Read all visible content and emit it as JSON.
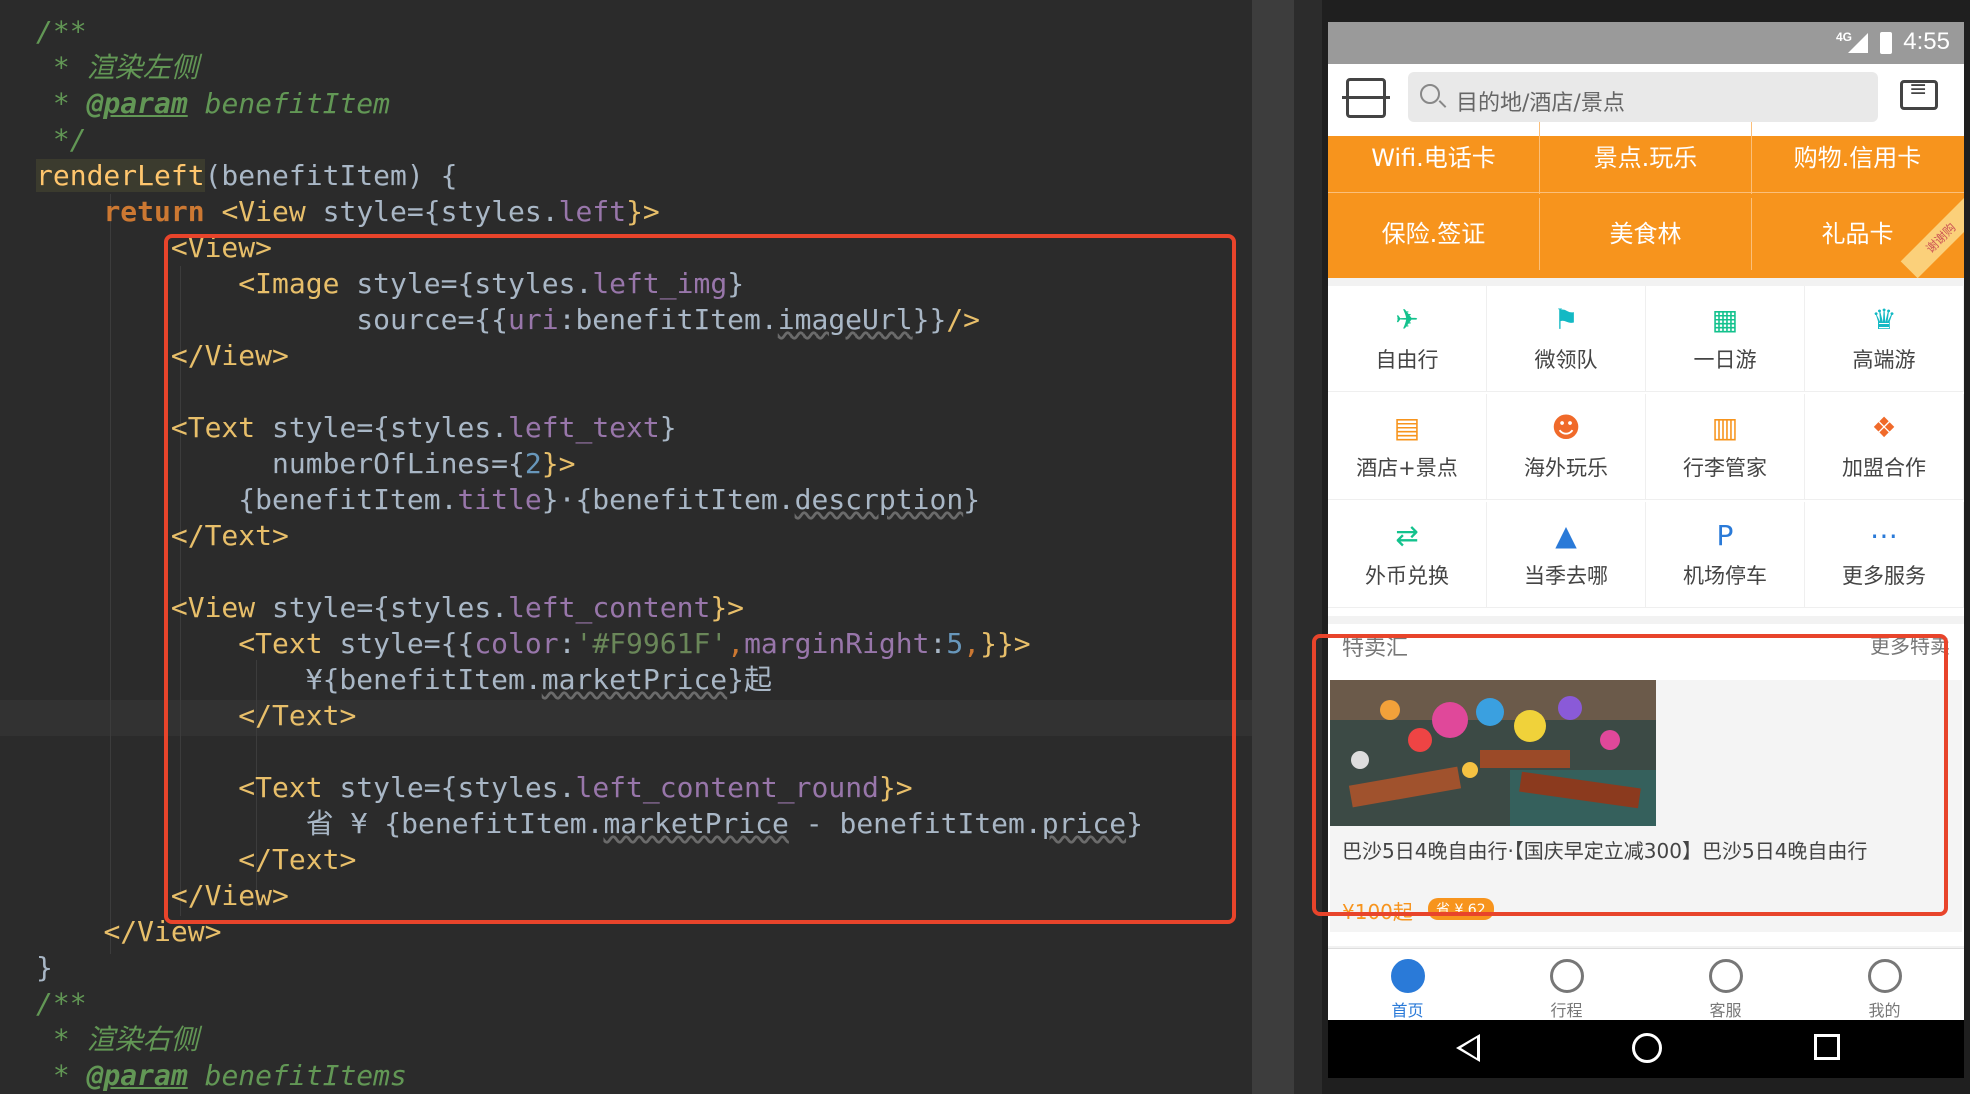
{
  "code": {
    "lines": [
      [
        {
          "t": "/**",
          "c": "c-comment"
        }
      ],
      [
        {
          "t": " * 渲染左侧",
          "c": "c-comment"
        }
      ],
      [
        {
          "t": " * ",
          "c": "c-comment"
        },
        {
          "t": "@param",
          "c": "c-tag-d"
        },
        {
          "t": " benefitItem",
          "c": "c-comment"
        }
      ],
      [
        {
          "t": " */",
          "c": "c-comment"
        }
      ],
      [
        {
          "t": "renderLeft",
          "c": "c-method"
        },
        {
          "t": "(benefitItem) {",
          "c": "c-plain"
        }
      ],
      [
        {
          "t": "    ",
          "c": "c-plain"
        },
        {
          "t": "return",
          "c": "c-kw"
        },
        {
          "t": " ",
          "c": "c-plain"
        },
        {
          "t": "<View ",
          "c": "c-tag"
        },
        {
          "t": "style",
          "c": "c-plain"
        },
        {
          "t": "={styles.",
          "c": "c-plain"
        },
        {
          "t": "left",
          "c": "c-prop"
        },
        {
          "t": "}>",
          "c": "c-tag"
        }
      ],
      [
        {
          "t": "        ",
          "c": "c-plain"
        },
        {
          "t": "<View>",
          "c": "c-tag"
        }
      ],
      [
        {
          "t": "            ",
          "c": "c-plain"
        },
        {
          "t": "<Image ",
          "c": "c-tag"
        },
        {
          "t": "style",
          "c": "c-plain"
        },
        {
          "t": "={styles.",
          "c": "c-plain"
        },
        {
          "t": "left_img",
          "c": "c-prop"
        },
        {
          "t": "}",
          "c": "c-plain"
        }
      ],
      [
        {
          "t": "                   source",
          "c": "c-plain"
        },
        {
          "t": "={{",
          "c": "c-plain"
        },
        {
          "t": "uri",
          "c": "c-prop"
        },
        {
          "t": ":benefitItem.",
          "c": "c-plain"
        },
        {
          "t": "imageUrl",
          "c": "c-chk"
        },
        {
          "t": "}}",
          "c": "c-plain"
        },
        {
          "t": "/>",
          "c": "c-tag"
        }
      ],
      [
        {
          "t": "        ",
          "c": "c-plain"
        },
        {
          "t": "</View>",
          "c": "c-tag"
        }
      ],
      [
        {
          "t": "",
          "c": "c-plain"
        }
      ],
      [
        {
          "t": "        ",
          "c": "c-plain"
        },
        {
          "t": "<Text ",
          "c": "c-tag"
        },
        {
          "t": "style",
          "c": "c-plain"
        },
        {
          "t": "={styles.",
          "c": "c-plain"
        },
        {
          "t": "left_text",
          "c": "c-prop"
        },
        {
          "t": "}",
          "c": "c-plain"
        }
      ],
      [
        {
          "t": "              numberOfLines",
          "c": "c-plain"
        },
        {
          "t": "={",
          "c": "c-plain"
        },
        {
          "t": "2",
          "c": "c-num"
        },
        {
          "t": "}>",
          "c": "c-tag"
        }
      ],
      [
        {
          "t": "            {benefitItem.",
          "c": "c-plain"
        },
        {
          "t": "title",
          "c": "c-prop"
        },
        {
          "t": "}·{benefitItem.",
          "c": "c-plain"
        },
        {
          "t": "descrption",
          "c": "c-chk"
        },
        {
          "t": "}",
          "c": "c-plain"
        }
      ],
      [
        {
          "t": "        ",
          "c": "c-plain"
        },
        {
          "t": "</Text>",
          "c": "c-tag"
        }
      ],
      [
        {
          "t": "",
          "c": "c-plain"
        }
      ],
      [
        {
          "t": "        ",
          "c": "c-plain"
        },
        {
          "t": "<View ",
          "c": "c-tag"
        },
        {
          "t": "style",
          "c": "c-plain"
        },
        {
          "t": "={styles.",
          "c": "c-plain"
        },
        {
          "t": "left_content",
          "c": "c-prop"
        },
        {
          "t": "}>",
          "c": "c-tag"
        }
      ],
      [
        {
          "t": "            ",
          "c": "c-plain"
        },
        {
          "t": "<Text ",
          "c": "c-tag"
        },
        {
          "t": "style",
          "c": "c-plain"
        },
        {
          "t": "={{",
          "c": "c-plain"
        },
        {
          "t": "color",
          "c": "c-prop"
        },
        {
          "t": ":",
          "c": "c-plain"
        },
        {
          "t": "'#F9961F'",
          "c": "c-str"
        },
        {
          "t": ",",
          "c": "c-op"
        },
        {
          "t": "marginRight",
          "c": "c-prop"
        },
        {
          "t": ":",
          "c": "c-plain"
        },
        {
          "t": "5",
          "c": "c-num"
        },
        {
          "t": ",",
          "c": "c-op"
        },
        {
          "t": "}}>",
          "c": "c-tag"
        }
      ],
      [
        {
          "t": "                ¥{benefitItem.",
          "c": "c-plain"
        },
        {
          "t": "marketPrice",
          "c": "c-chk"
        },
        {
          "t": "}起",
          "c": "c-plain"
        }
      ],
      [
        {
          "t": "            ",
          "c": "c-plain"
        },
        {
          "t": "</Text>",
          "c": "c-tag"
        }
      ],
      [
        {
          "t": "",
          "c": "c-plain"
        }
      ],
      [
        {
          "t": "            ",
          "c": "c-plain"
        },
        {
          "t": "<Text ",
          "c": "c-tag"
        },
        {
          "t": "style",
          "c": "c-plain"
        },
        {
          "t": "={styles.",
          "c": "c-plain"
        },
        {
          "t": "left_content_round",
          "c": "c-prop"
        },
        {
          "t": "}>",
          "c": "c-tag"
        }
      ],
      [
        {
          "t": "                省 ¥ {benefitItem.",
          "c": "c-plain"
        },
        {
          "t": "marketPrice",
          "c": "c-chk"
        },
        {
          "t": " - benefitItem.",
          "c": "c-plain"
        },
        {
          "t": "price",
          "c": "c-chk"
        },
        {
          "t": "}",
          "c": "c-plain"
        }
      ],
      [
        {
          "t": "            ",
          "c": "c-plain"
        },
        {
          "t": "</Text>",
          "c": "c-tag"
        }
      ],
      [
        {
          "t": "        ",
          "c": "c-plain"
        },
        {
          "t": "</View>",
          "c": "c-tag"
        }
      ],
      [
        {
          "t": "    ",
          "c": "c-plain"
        },
        {
          "t": "</View>",
          "c": "c-tag"
        }
      ],
      [
        {
          "t": "}",
          "c": "c-plain"
        }
      ],
      [
        {
          "t": "/**",
          "c": "c-comment"
        }
      ],
      [
        {
          "t": " * 渲染右侧",
          "c": "c-comment"
        }
      ],
      [
        {
          "t": " * ",
          "c": "c-comment"
        },
        {
          "t": "@param",
          "c": "c-tag-d"
        },
        {
          "t": " benefitItems",
          "c": "c-comment"
        }
      ]
    ]
  },
  "statusbar": {
    "network": "4G",
    "time": "4:55"
  },
  "search": {
    "placeholder": "目的地/酒店/景点"
  },
  "orange_grid": {
    "top_row": [
      "Wifi.电话卡",
      "景点.玩乐",
      "购物.信用卡"
    ],
    "bottom_row": [
      "保险.签证",
      "美食林",
      "礼品卡"
    ],
    "corner_tag": "谢谢购"
  },
  "services": [
    {
      "label": "自由行",
      "icon": "person-run-icon",
      "color": "#13c28d",
      "glyph": "✈"
    },
    {
      "label": "微领队",
      "icon": "flag-icon",
      "color": "#13b9c4",
      "glyph": "⚑"
    },
    {
      "label": "一日游",
      "icon": "calendar-icon",
      "color": "#13c28d",
      "glyph": "▦"
    },
    {
      "label": "高端游",
      "icon": "crown-icon",
      "color": "#13b9c4",
      "glyph": "♛"
    },
    {
      "label": "酒店+景点",
      "icon": "building-icon",
      "color": "#f7941d",
      "glyph": "▤"
    },
    {
      "label": "海外玩乐",
      "icon": "mask-icon",
      "color": "#f06a2a",
      "glyph": "☻"
    },
    {
      "label": "行李管家",
      "icon": "luggage-icon",
      "color": "#f7941d",
      "glyph": "▥"
    },
    {
      "label": "加盟合作",
      "icon": "handshake-icon",
      "color": "#f06a2a",
      "glyph": "❖"
    },
    {
      "label": "外币兑换",
      "icon": "exchange-icon",
      "color": "#13c28d",
      "glyph": "⇄"
    },
    {
      "label": "当季去哪",
      "icon": "thumbs-up-icon",
      "color": "#2a7ad8",
      "glyph": "▲"
    },
    {
      "label": "机场停车",
      "icon": "parking-icon",
      "color": "#2a7ad8",
      "glyph": "P"
    },
    {
      "label": "更多服务",
      "icon": "more-icon",
      "color": "#2a7ad8",
      "glyph": "⋯"
    }
  ],
  "deal": {
    "section_title": "特卖汇",
    "more": "更多特卖",
    "text": "巴沙5日4晚自由行·【国庆早定立减300】巴沙5日4晚自由行",
    "price": "¥100起",
    "save": "省 ¥ 62"
  },
  "tabs": [
    {
      "label": "首页",
      "icon": "home-icon",
      "active": true
    },
    {
      "label": "行程",
      "icon": "itinerary-icon",
      "active": false
    },
    {
      "label": "客服",
      "icon": "headset-icon",
      "active": false
    },
    {
      "label": "我的",
      "icon": "profile-icon",
      "active": false
    }
  ]
}
